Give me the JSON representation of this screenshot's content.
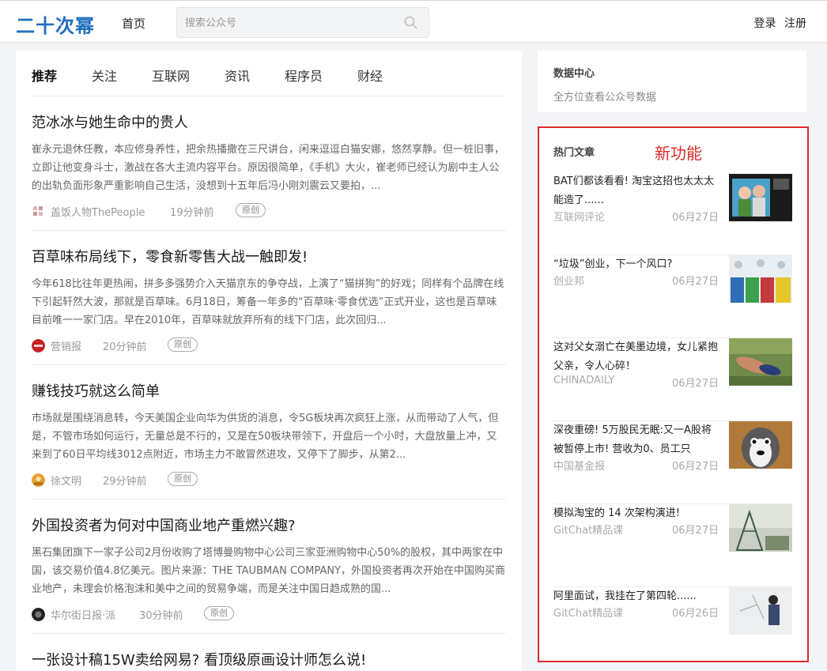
{
  "header": {
    "logo": "二十次幂",
    "nav_home": "首页",
    "search_placeholder": "搜索公众号",
    "login": "登录",
    "register": "注册"
  },
  "tabs": [
    "推荐",
    "关注",
    "互联网",
    "资讯",
    "程序员",
    "财经"
  ],
  "articles": [
    {
      "title": "范冰冰与她生命中的贵人",
      "summary": "崔永元退休任教，本应修身养性，把余热播撒在三尺讲台，闲来逗逗白猫安娜，悠然享静。但一桩旧事，立即让他变身斗士，激战在各大主流内容平台。原因很简单，《手机》大火，崔老师已经认为剧中主人公的出轨负面形象严重影响自己生活，没想到十五年后冯小刚刘震云又要拍，...",
      "source": "盖饭人物ThePeople",
      "time": "19分钟前",
      "badge": "原创"
    },
    {
      "title": "百草味布局线下，零食新零售大战一触即发!",
      "summary": "今年618比往年更热闹，拼多多强势介入天猫京东的争夺战，上演了“猫拼狗”的好戏；同样有个品牌在线下引起轩然大波，那就是百草味。6月18日，筹备一年多的“百草味·零食优选”正式开业，这也是百草味目前唯一一家门店。早在2010年，百草味就放弃所有的线下门店，此次回归...",
      "source": "营销报",
      "time": "20分钟前",
      "badge": "原创"
    },
    {
      "title": "赚钱技巧就这么简单",
      "summary": "市场就是围绕消息转，今天美国企业向华为供货的消息，令5G板块再次疯狂上涨，从而带动了人气，但是，不管市场如何运行，无量总是不行的，又是在50板块带领下，开盘后一个小时，大盘放量上冲，又来到了60日平均线3012点附近，市场主力不敢冒然进攻，又停下了脚步，从第2...",
      "source": "徐文明",
      "time": "29分钟前",
      "badge": "原创"
    },
    {
      "title": "外国投资者为何对中国商业地产重燃兴趣?",
      "summary": "黑石集团旗下一家子公司2月份收购了塔博曼购物中心公司三家亚洲购物中心50%的股权，其中两家在中国，该交易价值4.8亿美元。图片来源：THE TAUBMAN COMPANY，外国投资者再次开始在中国购买商业地产，未理会价格泡沫和美中之间的贸易争端，而是关注中国日趋成熟的国...",
      "source": "华尔街日报·派",
      "time": "30分钟前",
      "badge": "原创"
    },
    {
      "title": "一张设计稿15W卖给网易? 看顶级原画设计师怎么说!",
      "summary": "",
      "source": "",
      "time": "",
      "badge": ""
    }
  ],
  "sidebar": {
    "data_center_title": "数据中心",
    "data_center_sub": "全方位查看公众号数据",
    "hot_title": "热门文章",
    "new_feature": "新功能",
    "hot_items": [
      {
        "title": "BAT们都该看看! 淘宝这招也太太太能造了......",
        "source": "互联网评论",
        "date": "06月27日"
      },
      {
        "title": "“垃圾”创业，下一个风口?",
        "source": "创业邦",
        "date": "06月27日"
      },
      {
        "title": "这对父女溺亡在美墨边境，女儿紧抱父亲，令人心碎！",
        "source": "CHINADAILY",
        "date": "06月27日"
      },
      {
        "title": "深夜重磅! 5万股民无眠:又一A股将被暂停上市! 营收为0、员工只",
        "source": "中国基金报",
        "date": "06月27日"
      },
      {
        "title": "模拟淘宝的 14 次架构演进!",
        "source": "GitChat精品课",
        "date": "06月27日"
      },
      {
        "title": "阿里面试，我挂在了第四轮......",
        "source": "GitChat精品课",
        "date": "06月26日"
      }
    ]
  },
  "colors": {
    "brand": "#1f6fbf",
    "highlight": "#e02a2a"
  }
}
